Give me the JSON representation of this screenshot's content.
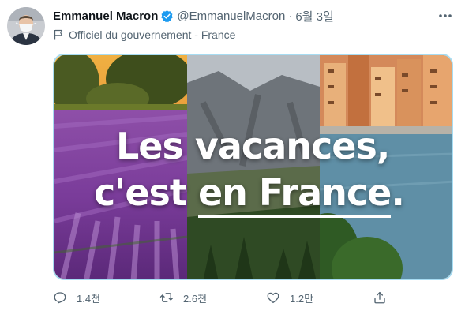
{
  "author": {
    "display_name": "Emmanuel Macron",
    "handle": "@EmmanuelMacron",
    "separator": "·",
    "date": "6월 3일",
    "verified_icon": "verified-badge-icon",
    "label": "Officiel du gouvernement - France",
    "label_icon": "flag-icon"
  },
  "media": {
    "line1": "Les vacances,",
    "line2_prefix": "c'est ",
    "line2_underlined": "en France",
    "line2_suffix": "."
  },
  "actions": {
    "reply_count": "1.4천",
    "retweet_count": "2.6천",
    "like_count": "1.2만"
  },
  "colors": {
    "verified": "#1d9bf0",
    "secondary_text": "#536471",
    "media_border": "#a7dcf2"
  }
}
